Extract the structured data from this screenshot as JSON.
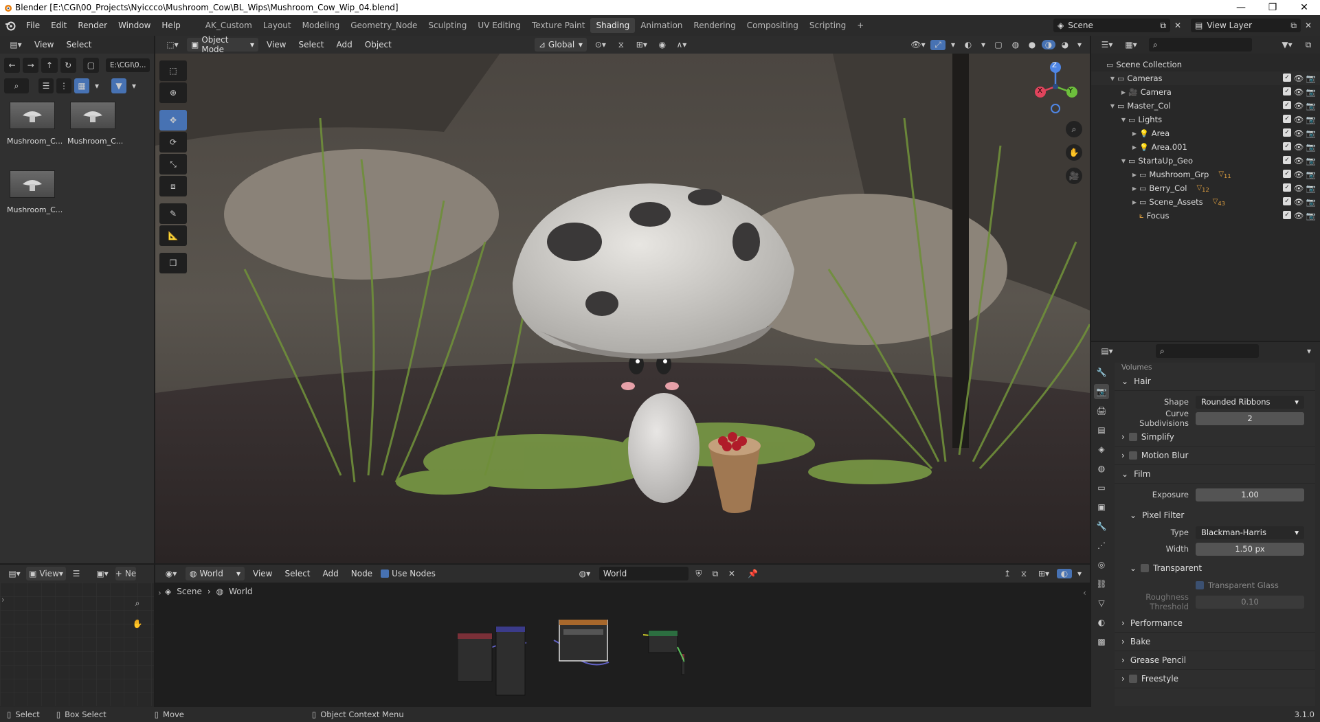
{
  "titlebar": {
    "title": "Blender [E:\\CGI\\00_Projects\\Nyiccco\\Mushroom_Cow\\BL_Wips\\Mushroom_Cow_Wip_04.blend]",
    "minimize": "—",
    "maximize": "❐",
    "close": "✕"
  },
  "menu": [
    "File",
    "Edit",
    "Render",
    "Window",
    "Help"
  ],
  "workspaces": [
    "AK_Custom",
    "Layout",
    "Modeling",
    "Geometry_Node",
    "Sculpting",
    "UV Editing",
    "Texture Paint",
    "Shading",
    "Animation",
    "Rendering",
    "Compositing",
    "Scripting"
  ],
  "active_workspace": "Shading",
  "scene_field": "Scene",
  "view_layer_field": "View Layer",
  "file_browser": {
    "menu": [
      "View",
      "Select"
    ],
    "path": "E:\\CGI\\0...",
    "thumbnails": [
      "Mushroom_C...",
      "Mushroom_C...",
      "Mushroom_C..."
    ]
  },
  "viewport_header": {
    "mode": "Object Mode",
    "menus": [
      "View",
      "Select",
      "Add",
      "Object"
    ],
    "orientation": "Global"
  },
  "gizmo": {
    "z": "Z",
    "y": "Y",
    "x": "X"
  },
  "outliner": {
    "rows": [
      {
        "label": "Scene Collection",
        "level": 0,
        "toggle": "",
        "icon": "scene-collection-icon",
        "vis": false
      },
      {
        "label": "Cameras",
        "level": 1,
        "toggle": "▼",
        "icon": "collection-icon",
        "vis": true
      },
      {
        "label": "Camera",
        "level": 2,
        "toggle": "▶",
        "icon": "camera-icon",
        "vis": true
      },
      {
        "label": "Master_Col",
        "level": 1,
        "toggle": "▼",
        "icon": "collection-icon",
        "vis": true
      },
      {
        "label": "Lights",
        "level": 2,
        "toggle": "▼",
        "icon": "collection-icon",
        "vis": true
      },
      {
        "label": "Area",
        "level": 3,
        "toggle": "▶",
        "icon": "light-icon",
        "vis": true
      },
      {
        "label": "Area.001",
        "level": 3,
        "toggle": "▶",
        "icon": "light-icon",
        "vis": true
      },
      {
        "label": "StartaUp_Geo",
        "level": 2,
        "toggle": "▼",
        "icon": "collection-icon",
        "vis": true
      },
      {
        "label": "Mushroom_Grp",
        "level": 3,
        "toggle": "▶",
        "icon": "collection-icon",
        "vis": true,
        "badge": "11"
      },
      {
        "label": "Berry_Col",
        "level": 3,
        "toggle": "▶",
        "icon": "collection-icon",
        "vis": true,
        "badge": "12"
      },
      {
        "label": "Scene_Assets",
        "level": 3,
        "toggle": "▶",
        "icon": "collection-icon",
        "vis": true,
        "badge": "43"
      },
      {
        "label": "Focus",
        "level": 3,
        "toggle": "",
        "icon": "empty-icon",
        "vis": true
      }
    ]
  },
  "properties": {
    "partial_top": "Volumes",
    "hair_title": "Hair",
    "shape_label": "Shape",
    "shape_value": "Rounded Ribbons",
    "curve_sub_label": "Curve Subdivisions",
    "curve_sub_value": "2",
    "simplify": "Simplify",
    "motion_blur": "Motion Blur",
    "film": "Film",
    "exposure_label": "Exposure",
    "exposure_value": "1.00",
    "pixel_filter": "Pixel Filter",
    "type_label": "Type",
    "type_value": "Blackman-Harris",
    "width_label": "Width",
    "width_value": "1.50 px",
    "transparent": "Transparent",
    "transparent_glass": "Transparent Glass",
    "roughness_label": "Roughness Threshold",
    "roughness_value": "0.10",
    "performance": "Performance",
    "bake": "Bake",
    "grease_pencil": "Grease Pencil",
    "freestyle": "Freestyle"
  },
  "node_editor": {
    "left_menu": "View",
    "left_add": "Ne",
    "world_selector": "World",
    "menus": [
      "View",
      "Select",
      "Add",
      "Node"
    ],
    "use_nodes": "Use Nodes",
    "world_field": "World",
    "breadcrumb_scene": "Scene",
    "breadcrumb_world": "World"
  },
  "statusbar": {
    "select": "Select",
    "box_select": "Box Select",
    "move": "Move",
    "context": "Object Context Menu",
    "version": "3.1.0"
  }
}
